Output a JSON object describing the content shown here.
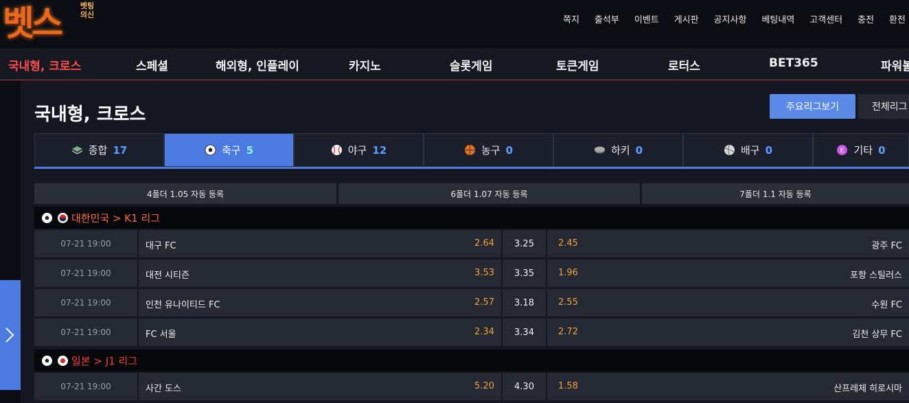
{
  "logo": {
    "main": "벳스",
    "sub": "벳팅의신"
  },
  "top_nav": [
    "쪽지",
    "출석부",
    "이벤트",
    "게시판",
    "공지사항",
    "베팅내역",
    "고객센터",
    "충전",
    "환전"
  ],
  "main_nav": [
    "국내형, 크로스",
    "스페셜",
    "해외형, 인플레이",
    "카지노",
    "슬롯게임",
    "토큰게임",
    "로터스",
    "BET365",
    "파워볼"
  ],
  "page": {
    "title": "국내형, 크로스",
    "btn_major": "주요리그보기",
    "btn_all": "전체리그"
  },
  "sport_tabs": [
    {
      "label": "종합",
      "count": "17",
      "icon": "layers-icon"
    },
    {
      "label": "축구",
      "count": "5",
      "icon": "soccer-ball-icon"
    },
    {
      "label": "야구",
      "count": "12",
      "icon": "baseball-icon"
    },
    {
      "label": "농구",
      "count": "0",
      "icon": "basketball-icon"
    },
    {
      "label": "하키",
      "count": "0",
      "icon": "hockey-puck-icon"
    },
    {
      "label": "배구",
      "count": "0",
      "icon": "volleyball-icon"
    },
    {
      "label": "기타",
      "count": "0",
      "icon": "etc-icon"
    }
  ],
  "folder_bonus": [
    "4폴더 1.05 자동 등록",
    "6폴더 1.07 자동 등록",
    "7폴더 1.1 자동 등록"
  ],
  "leagues": [
    {
      "name": "대한민국 > K1 리그",
      "matches": [
        {
          "time": "07-21 19:00",
          "home": "대구 FC",
          "home_odd": "2.64",
          "draw": "3.25",
          "away_odd": "2.45",
          "away": "광주 FC"
        },
        {
          "time": "07-21 19:00",
          "home": "대전 시티즌",
          "home_odd": "3.53",
          "draw": "3.35",
          "away_odd": "1.96",
          "away": "포항 스틸러스"
        },
        {
          "time": "07-21 19:00",
          "home": "인천 유나이티드 FC",
          "home_odd": "2.57",
          "draw": "3.18",
          "away_odd": "2.55",
          "away": "수원 FC"
        },
        {
          "time": "07-21 19:00",
          "home": "FC 서울",
          "home_odd": "2.34",
          "draw": "3.34",
          "away_odd": "2.72",
          "away": "김천 상무 FC"
        }
      ]
    },
    {
      "name": "일본 > J1 리그",
      "matches": [
        {
          "time": "07-21 19:00",
          "home": "사간 도스",
          "home_odd": "5.20",
          "draw": "4.30",
          "away_odd": "1.58",
          "away": "산프레체 히로시마"
        }
      ]
    }
  ],
  "colors": {
    "accent": "#4b7be0",
    "odd": "#f2a33a",
    "active_nav": "#ff4a4a"
  }
}
